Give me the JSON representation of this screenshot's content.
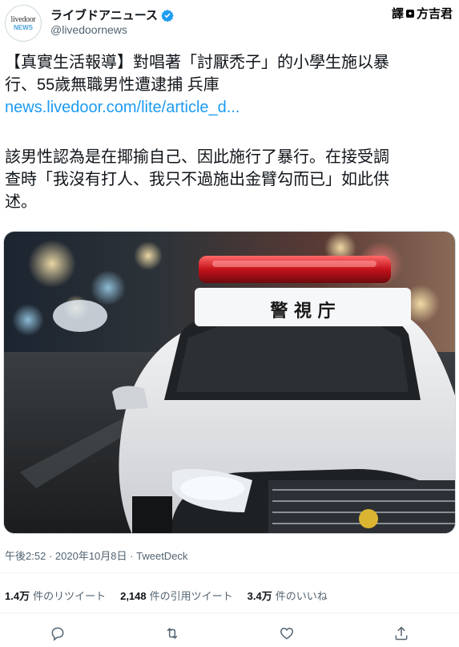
{
  "account": {
    "avatar_line1": "livedoor",
    "avatar_line2": "NEWS",
    "display_name": "ライブドアニュース",
    "handle": "@livedoornews"
  },
  "watermark": {
    "prefix": "譯",
    "dot": "●",
    "name": "方吉君"
  },
  "tweet": {
    "line1": "【真實生活報導】對唱著「討厭禿子」的小學生施以暴",
    "line2": "行、55歲無職男性遭逮捕 兵庫",
    "link": "news.livedoor.com/lite/article_d...",
    "para2_line1": "該男性認為是在揶揄自己、因此施行了暴行。在接受調",
    "para2_line2": "查時「我沒有打人、我只不過施出金臂勾而已」如此供",
    "para2_line3": "述。",
    "photo_sign": "警 視 庁"
  },
  "meta": {
    "time": "午後2:52",
    "sep1": "·",
    "date": "2020年10月8日",
    "sep2": "·",
    "source": "TweetDeck"
  },
  "stats": {
    "retweets_count": "1.4万",
    "retweets_label": "件のリツイート",
    "quotes_count": "2,148",
    "quotes_label": "件の引用ツイート",
    "likes_count": "3.4万",
    "likes_label": "件のいいね"
  },
  "colors": {
    "link": "#1d9bf0",
    "verified": "#1d9bf0",
    "muted": "#536471"
  }
}
